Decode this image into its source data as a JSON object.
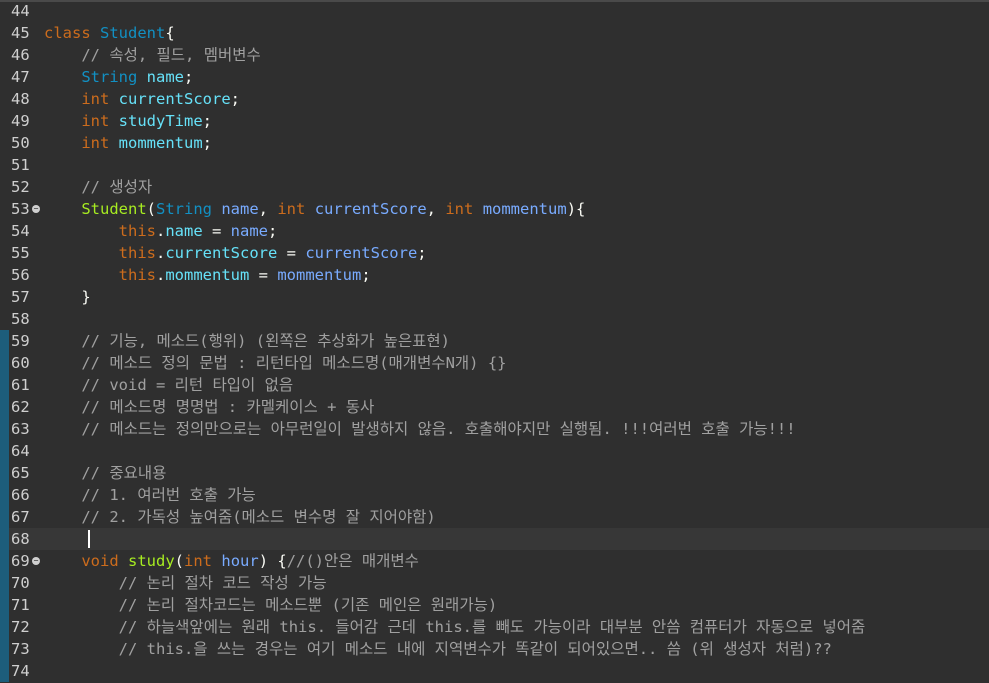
{
  "editor": {
    "caret_line": "68",
    "lines": [
      {
        "num": "44",
        "tokens": []
      },
      {
        "num": "45",
        "tokens": [
          {
            "t": "class ",
            "c": "kw"
          },
          {
            "t": "Student",
            "c": "cls"
          },
          {
            "t": "{",
            "c": "punc"
          }
        ]
      },
      {
        "num": "46",
        "tokens": [
          {
            "t": "    // 속성, 필드, 멤버변수",
            "c": "cmt"
          }
        ]
      },
      {
        "num": "47",
        "tokens": [
          {
            "t": "    ",
            "c": "plain"
          },
          {
            "t": "String",
            "c": "type"
          },
          {
            "t": " ",
            "c": "plain"
          },
          {
            "t": "name",
            "c": "field"
          },
          {
            "t": ";",
            "c": "punc"
          }
        ]
      },
      {
        "num": "48",
        "tokens": [
          {
            "t": "    ",
            "c": "plain"
          },
          {
            "t": "int",
            "c": "kw"
          },
          {
            "t": " ",
            "c": "plain"
          },
          {
            "t": "currentScore",
            "c": "field"
          },
          {
            "t": ";",
            "c": "punc"
          }
        ]
      },
      {
        "num": "49",
        "tokens": [
          {
            "t": "    ",
            "c": "plain"
          },
          {
            "t": "int",
            "c": "kw"
          },
          {
            "t": " ",
            "c": "plain"
          },
          {
            "t": "studyTime",
            "c": "field"
          },
          {
            "t": ";",
            "c": "punc"
          }
        ]
      },
      {
        "num": "50",
        "tokens": [
          {
            "t": "    ",
            "c": "plain"
          },
          {
            "t": "int",
            "c": "kw"
          },
          {
            "t": " ",
            "c": "plain"
          },
          {
            "t": "mommentum",
            "c": "field"
          },
          {
            "t": ";",
            "c": "punc"
          }
        ]
      },
      {
        "num": "51",
        "tokens": []
      },
      {
        "num": "52",
        "tokens": [
          {
            "t": "    // 생성자",
            "c": "cmt"
          }
        ]
      },
      {
        "num": "53",
        "fold": "true",
        "tokens": [
          {
            "t": "    ",
            "c": "plain"
          },
          {
            "t": "Student",
            "c": "fn"
          },
          {
            "t": "(",
            "c": "punc"
          },
          {
            "t": "String",
            "c": "type"
          },
          {
            "t": " ",
            "c": "plain"
          },
          {
            "t": "name",
            "c": "param"
          },
          {
            "t": ", ",
            "c": "punc"
          },
          {
            "t": "int",
            "c": "kw"
          },
          {
            "t": " ",
            "c": "plain"
          },
          {
            "t": "currentScore",
            "c": "param"
          },
          {
            "t": ", ",
            "c": "punc"
          },
          {
            "t": "int",
            "c": "kw"
          },
          {
            "t": " ",
            "c": "plain"
          },
          {
            "t": "mommentum",
            "c": "param"
          },
          {
            "t": "){",
            "c": "punc"
          }
        ]
      },
      {
        "num": "54",
        "tokens": [
          {
            "t": "        ",
            "c": "plain"
          },
          {
            "t": "this",
            "c": "this"
          },
          {
            "t": ".",
            "c": "punc"
          },
          {
            "t": "name",
            "c": "field"
          },
          {
            "t": " = ",
            "c": "punc"
          },
          {
            "t": "name",
            "c": "param"
          },
          {
            "t": ";",
            "c": "punc"
          }
        ]
      },
      {
        "num": "55",
        "tokens": [
          {
            "t": "        ",
            "c": "plain"
          },
          {
            "t": "this",
            "c": "this"
          },
          {
            "t": ".",
            "c": "punc"
          },
          {
            "t": "currentScore",
            "c": "field"
          },
          {
            "t": " = ",
            "c": "punc"
          },
          {
            "t": "currentScore",
            "c": "param"
          },
          {
            "t": ";",
            "c": "punc"
          }
        ]
      },
      {
        "num": "56",
        "tokens": [
          {
            "t": "        ",
            "c": "plain"
          },
          {
            "t": "this",
            "c": "this"
          },
          {
            "t": ".",
            "c": "punc"
          },
          {
            "t": "mommentum",
            "c": "field"
          },
          {
            "t": " = ",
            "c": "punc"
          },
          {
            "t": "mommentum",
            "c": "param"
          },
          {
            "t": ";",
            "c": "punc"
          }
        ]
      },
      {
        "num": "57",
        "tokens": [
          {
            "t": "    }",
            "c": "punc"
          }
        ]
      },
      {
        "num": "58",
        "tokens": []
      },
      {
        "num": "59",
        "bar": "true",
        "tokens": [
          {
            "t": "    // 기능, 메소드(행위) (왼쪽은 추상화가 높은표현)",
            "c": "cmt"
          }
        ]
      },
      {
        "num": "60",
        "bar": "true",
        "tokens": [
          {
            "t": "    // 메소드 정의 문법 : 리턴타입 메소드명(매개변수N개) {}",
            "c": "cmt"
          }
        ]
      },
      {
        "num": "61",
        "bar": "true",
        "tokens": [
          {
            "t": "    // void = 리턴 타입이 없음",
            "c": "cmt"
          }
        ]
      },
      {
        "num": "62",
        "bar": "true",
        "tokens": [
          {
            "t": "    // 메소드명 명명법 : 카멜케이스 + 동사",
            "c": "cmt"
          }
        ]
      },
      {
        "num": "63",
        "bar": "true",
        "tokens": [
          {
            "t": "    // 메소드는 정의만으로는 아무런일이 발생하지 않음. 호출해야지만 실행됨. !!!여러번 호출 가능!!!",
            "c": "cmt"
          }
        ]
      },
      {
        "num": "64",
        "bar": "true",
        "tokens": []
      },
      {
        "num": "65",
        "bar": "true",
        "tokens": [
          {
            "t": "    // 중요내용",
            "c": "cmt"
          }
        ]
      },
      {
        "num": "66",
        "bar": "true",
        "tokens": [
          {
            "t": "    // 1. 여러번 호출 가능",
            "c": "cmt"
          }
        ]
      },
      {
        "num": "67",
        "bar": "true",
        "tokens": [
          {
            "t": "    // 2. 가독성 높여줌(메소드 변수명 잘 지어야함)",
            "c": "cmt"
          }
        ]
      },
      {
        "num": "68",
        "bar": "true",
        "current": "true",
        "tokens": []
      },
      {
        "num": "69",
        "bar": "true",
        "fold": "true",
        "tokens": [
          {
            "t": "    ",
            "c": "plain"
          },
          {
            "t": "void",
            "c": "kw"
          },
          {
            "t": " ",
            "c": "plain"
          },
          {
            "t": "study",
            "c": "fn"
          },
          {
            "t": "(",
            "c": "punc"
          },
          {
            "t": "int",
            "c": "kw"
          },
          {
            "t": " ",
            "c": "plain"
          },
          {
            "t": "hour",
            "c": "param"
          },
          {
            "t": ") {",
            "c": "punc"
          },
          {
            "t": "//()안은 매개변수",
            "c": "cmt"
          }
        ]
      },
      {
        "num": "70",
        "bar": "true",
        "tokens": [
          {
            "t": "        // 논리 절차 코드 작성 가능",
            "c": "cmt"
          }
        ]
      },
      {
        "num": "71",
        "bar": "true",
        "tokens": [
          {
            "t": "        // 논리 절차코드는 메소드뿐 (기존 메인은 원래가능)",
            "c": "cmt"
          }
        ]
      },
      {
        "num": "72",
        "bar": "true",
        "tokens": [
          {
            "t": "        // 하늘색앞에는 원래 this. 들어감 근데 this.를 빼도 가능이라 대부분 안씀 컴퓨터가 자동으로 넣어줌",
            "c": "cmt"
          }
        ]
      },
      {
        "num": "73",
        "bar": "true",
        "tokens": [
          {
            "t": "        // this.을 쓰는 경우는 여기 메소드 내에 지역변수가 똑같이 되어있으면.. 씀 (위 생성자 처럼)??",
            "c": "cmt"
          }
        ]
      },
      {
        "num": "74",
        "bar": "true",
        "tokens": []
      }
    ]
  }
}
